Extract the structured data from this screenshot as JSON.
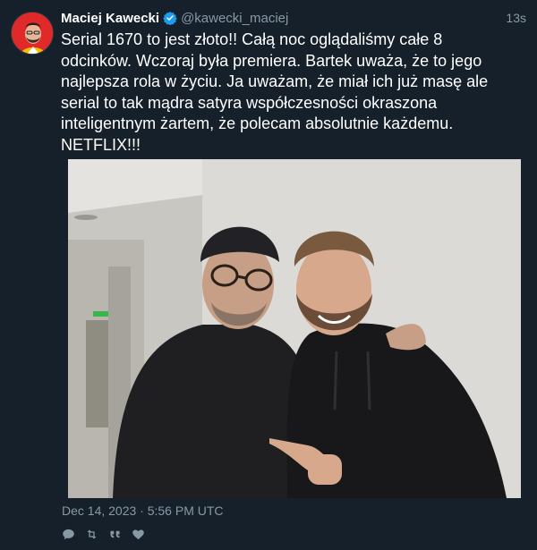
{
  "tweet": {
    "author": {
      "display_name": "Maciej Kawecki",
      "handle": "@kawecki_maciej",
      "verified": true
    },
    "relative_time": "13s",
    "text": "Serial 1670 to jest złoto!! Całą noc oglądaliśmy całe 8 odcinków. Wczoraj była premiera. Bartek uważa, że to jego najlepsza rola w życiu. Ja uważam, że miał ich już masę ale serial to tak mądra satyra współczesności okraszona inteligentnym żartem, że polecam absolutnie każdemu. NETFLIX!!!",
    "date": "Dec 14, 2023 · 5:56 PM UTC",
    "media": {
      "kind": "photo"
    }
  },
  "actions": [
    {
      "icon": "reply-icon"
    },
    {
      "icon": "retweet-icon"
    },
    {
      "icon": "quote-icon"
    },
    {
      "icon": "like-icon"
    }
  ],
  "colors": {
    "background": "#15202b",
    "muted": "#8899a6",
    "verified": "#1d9bf0",
    "avatar_bg": "#e02a2a"
  }
}
